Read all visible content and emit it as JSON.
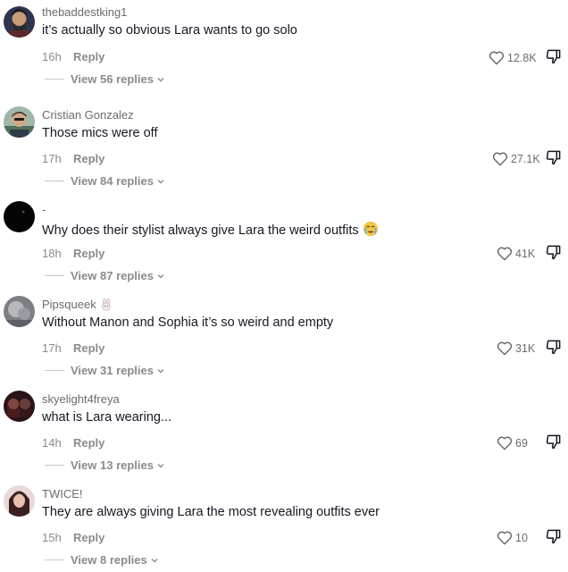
{
  "comments": [
    {
      "username": "thebaddestking1",
      "text": "it’s actually so obvious Lara wants to go solo",
      "time": "16h",
      "reply_label": "Reply",
      "likes": "12.8K",
      "view_replies": "View 56 replies",
      "avatar_color": "#3b3f5c"
    },
    {
      "username": "Cristian Gonzalez",
      "text": "Those mics were off",
      "time": "17h",
      "reply_label": "Reply",
      "likes": "27.1K",
      "view_replies": "View 84 replies",
      "avatar_color": "#7a9a7a"
    },
    {
      "username": "-",
      "text": "Why does their stylist always give Lara the weird outfits",
      "time": "18h",
      "reply_label": "Reply",
      "likes": "41K",
      "view_replies": "View 87 replies",
      "avatar_color": "#0a0a0a"
    },
    {
      "username": "Pipsqueek",
      "text": "Without Manon and Sophia it’s so weird and empty",
      "time": "17h",
      "reply_label": "Reply",
      "likes": "31K",
      "view_replies": "View 31 replies",
      "avatar_color": "#8e8e96"
    },
    {
      "username": "skyelight4freya",
      "text": "what is Lara wearing...",
      "time": "14h",
      "reply_label": "Reply",
      "likes": "69",
      "view_replies": "View 13 replies",
      "avatar_color": "#3a1f28"
    },
    {
      "username": "TWICE!",
      "text": "They are always giving Lara the most revealing outfits ever",
      "time": "15h",
      "reply_label": "Reply",
      "likes": "10",
      "view_replies": "View 8 replies",
      "avatar_color": "#5a3b3b"
    }
  ]
}
